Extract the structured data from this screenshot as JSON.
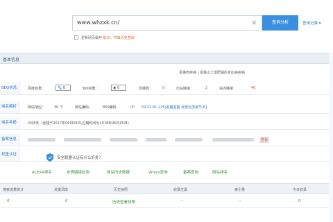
{
  "search": {
    "value": "www.whzxk.cn/",
    "button_label": "查询分析",
    "history_label": "查询记录 ▾",
    "checkbox_label": "更新网页缓存",
    "checkbox_hint": "提示：开启历史查询"
  },
  "section": {
    "title": "基本信息",
    "notice": "黑猫修疾病 | 黑猫山土壤肥辅的发疝病疾病"
  },
  "rows": {
    "seo": {
      "label": "SEO信息",
      "baidu_label": "百度权重：",
      "baidu_value": "0",
      "s360_label": "360权重：",
      "s360_value": "0",
      "fanlian_label": "反链数：",
      "fanlian_value": "0",
      "outlink_label": "出站链接：",
      "outlink_value": "2",
      "inlink_label": "站内链接：",
      "inlink_value": "40"
    },
    "resolve": {
      "label": "域名解析",
      "speed_label": "网站响应：",
      "speed_value": "30 个",
      "encode_label": "网站编码：",
      "encode_value": "850编码",
      "ip_label": "IP：",
      "ip_value": "59.52.81.225[黑猫黑猫 百度云加速节点]"
    },
    "domain": {
      "label": "域名年龄",
      "value": "2月8天（创建于2017年06月05日,过期时间为2018年06月05日)"
    },
    "record": {
      "label": "备案信息",
      "badge": "查看"
    },
    "trust": {
      "label": "权重认证",
      "text": "安全联盟认证有什么好处？"
    }
  },
  "links": [
    "ALEXA排名",
    "友情链接检测",
    "网站历史数据",
    "Whois查询",
    "备案查询",
    "网站排名"
  ],
  "table": {
    "headers": [
      "搜索流量统计",
      "关键词库",
      "历史快照",
      "收录位置",
      "索引量",
      "今日收录"
    ],
    "values": [
      "0",
      "0",
      "历史查看快照",
      "--",
      "--",
      "0"
    ]
  },
  "colors": {
    "accent": "#3b8fe0",
    "link_blue": "#2d77c9",
    "link_green": "#3b8f3b",
    "warning_red": "#e03a2a"
  }
}
